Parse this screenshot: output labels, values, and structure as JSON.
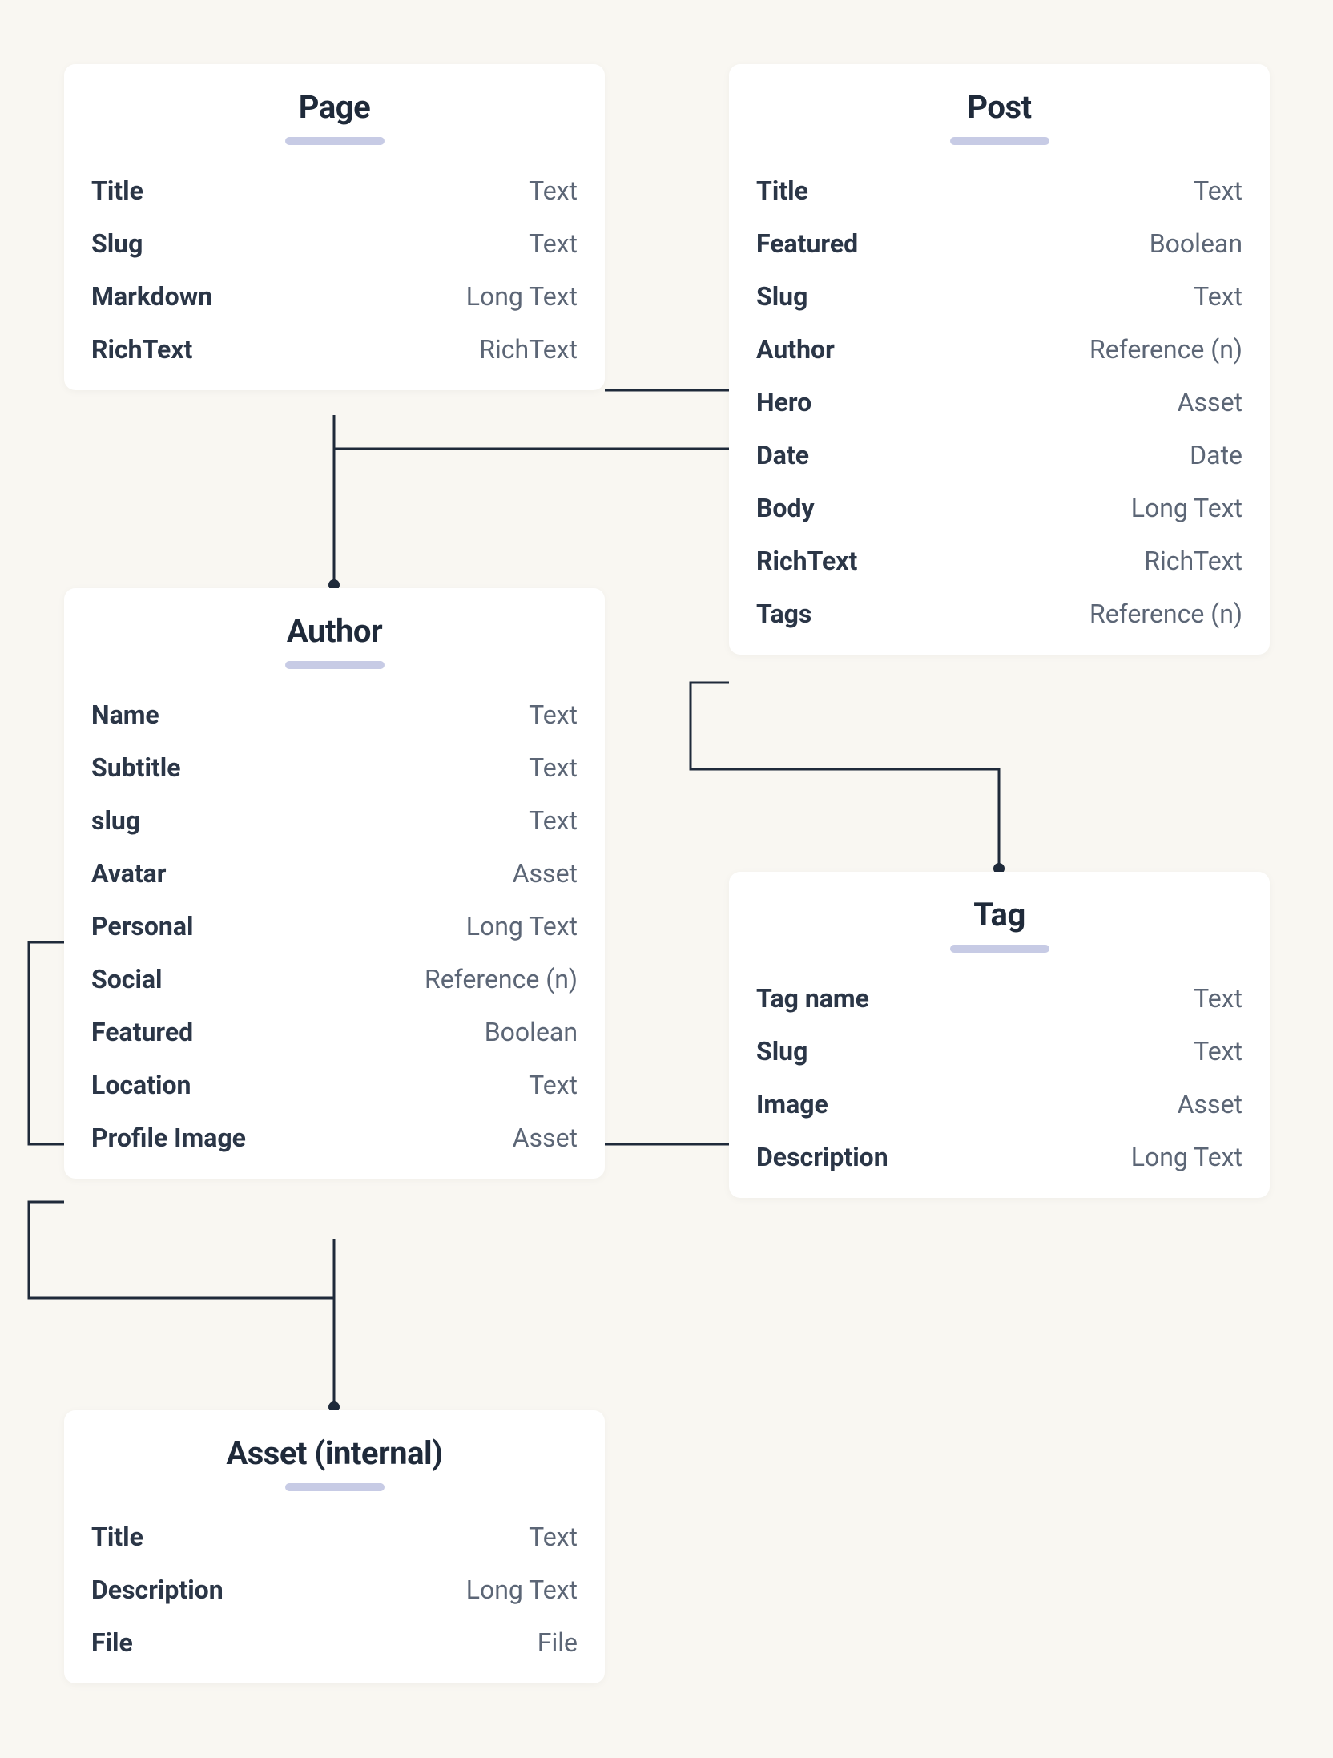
{
  "entities": {
    "page": {
      "title": "Page",
      "fields": [
        {
          "name": "Title",
          "type": "Text"
        },
        {
          "name": "Slug",
          "type": "Text"
        },
        {
          "name": "Markdown",
          "type": "Long Text"
        },
        {
          "name": "RichText",
          "type": "RichText"
        }
      ]
    },
    "post": {
      "title": "Post",
      "fields": [
        {
          "name": "Title",
          "type": "Text"
        },
        {
          "name": "Featured",
          "type": "Boolean"
        },
        {
          "name": "Slug",
          "type": "Text"
        },
        {
          "name": "Author",
          "type": "Reference (n)"
        },
        {
          "name": "Hero",
          "type": "Asset"
        },
        {
          "name": "Date",
          "type": "Date"
        },
        {
          "name": "Body",
          "type": "Long Text"
        },
        {
          "name": "RichText",
          "type": "RichText"
        },
        {
          "name": "Tags",
          "type": "Reference (n)"
        }
      ]
    },
    "author": {
      "title": "Author",
      "fields": [
        {
          "name": "Name",
          "type": "Text"
        },
        {
          "name": "Subtitle",
          "type": "Text"
        },
        {
          "name": "slug",
          "type": "Text"
        },
        {
          "name": "Avatar",
          "type": "Asset"
        },
        {
          "name": "Personal",
          "type": "Long Text"
        },
        {
          "name": "Social",
          "type": "Reference (n)"
        },
        {
          "name": "Featured",
          "type": "Boolean"
        },
        {
          "name": "Location",
          "type": "Text"
        },
        {
          "name": "Profile Image",
          "type": "Asset"
        }
      ]
    },
    "tag": {
      "title": "Tag",
      "fields": [
        {
          "name": "Tag name",
          "type": "Text"
        },
        {
          "name": "Slug",
          "type": "Text"
        },
        {
          "name": "Image",
          "type": "Asset"
        },
        {
          "name": "Description",
          "type": "Long Text"
        }
      ]
    },
    "asset": {
      "title": "Asset (internal)",
      "fields": [
        {
          "name": "Title",
          "type": "Text"
        },
        {
          "name": "Description",
          "type": "Long Text"
        },
        {
          "name": "File",
          "type": "File"
        }
      ]
    }
  },
  "connections": [
    {
      "from": "post.Author",
      "to": "author"
    },
    {
      "from": "post.Hero",
      "to": "author (via line)"
    },
    {
      "from": "post.Tags",
      "to": "tag"
    },
    {
      "from": "author.Avatar",
      "to": "asset (loop)"
    },
    {
      "from": "author.Location",
      "to": "tag.Image (line)"
    },
    {
      "from": "author.ProfileImage",
      "to": "asset"
    },
    {
      "from": "page.RichText",
      "to": "post (line)"
    }
  ]
}
